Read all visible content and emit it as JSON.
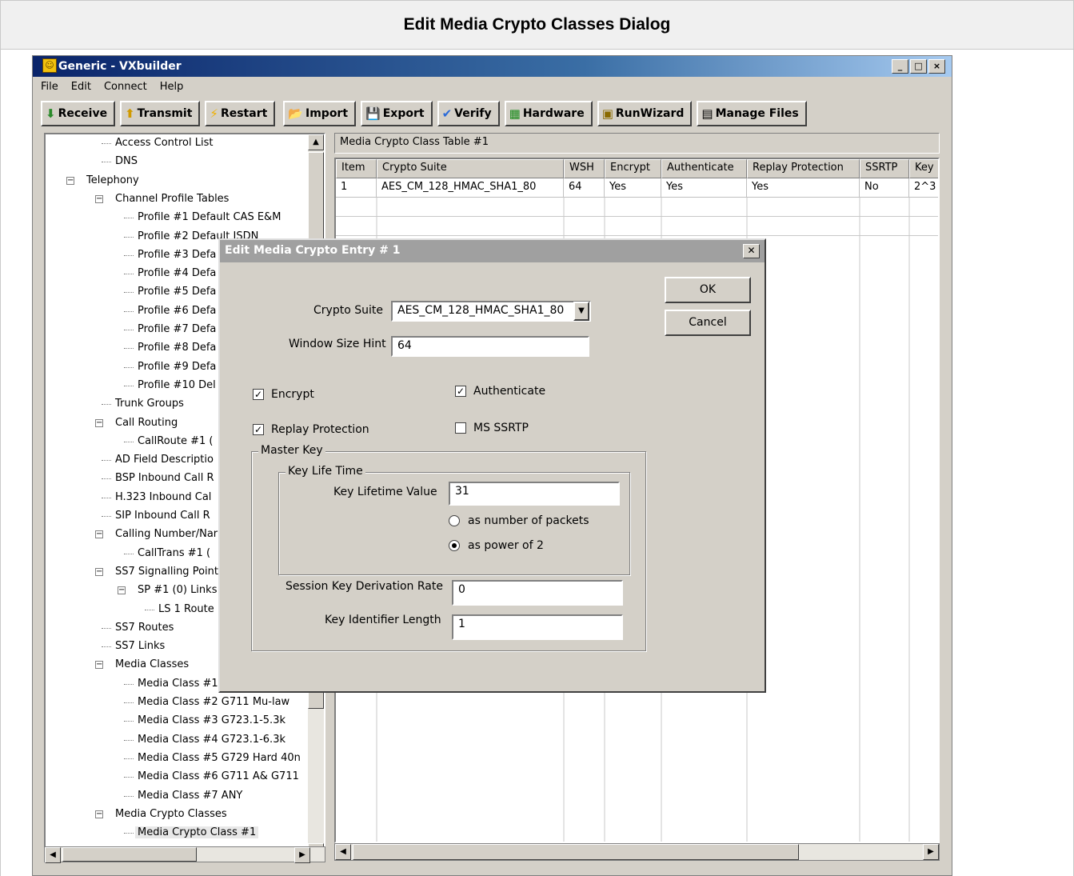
{
  "caption": "Edit Media Crypto Classes Dialog",
  "window": {
    "title": "Generic - VXbuilder",
    "controls": [
      "_",
      "□",
      "×"
    ]
  },
  "menu": [
    "File",
    "Edit",
    "Connect",
    "Help"
  ],
  "toolbar": [
    {
      "label": "Receive",
      "icon": "receive-icon"
    },
    {
      "label": "Transmit",
      "icon": "transmit-icon"
    },
    {
      "label": "Restart",
      "icon": "restart-icon"
    },
    {
      "label": "Import",
      "icon": "import-icon"
    },
    {
      "label": "Export",
      "icon": "export-icon"
    },
    {
      "label": "Verify",
      "icon": "verify-icon"
    },
    {
      "label": "Hardware",
      "icon": "hardware-icon"
    },
    {
      "label": "RunWizard",
      "icon": "runwizard-icon"
    },
    {
      "label": "Manage Files",
      "icon": "manage-files-icon"
    }
  ],
  "tree": [
    "Access Control List",
    "DNS",
    "Telephony",
    "Channel Profile Tables",
    "Profile #1 Default CAS E&M",
    "Profile #2 Default ISDN",
    "Profile #3 Defa",
    "Profile #4 Defa",
    "Profile #5 Defa",
    "Profile #6 Defa",
    "Profile #7 Defa",
    "Profile #8 Defa",
    "Profile #9 Defa",
    "Profile #10 Del",
    "Trunk Groups",
    "Call Routing",
    "CallRoute #1 (",
    "AD Field Descriptio",
    "BSP Inbound Call R",
    "H.323 Inbound Cal",
    "SIP Inbound Call R",
    "Calling Number/Nar",
    "CallTrans #1 (",
    "SS7 Signalling Point",
    "SP #1 (0) Links",
    "LS 1 Route",
    "SS7 Routes",
    "SS7 Links",
    "Media Classes",
    "Media Class #1",
    "Media Class #2 G711 Mu-law",
    "Media Class #3 G723.1-5.3k",
    "Media Class #4 G723.1-6.3k",
    "Media Class #5 G729 Hard 40n",
    "Media Class #6 G711 A& G711",
    "Media Class #7 ANY",
    "Media Crypto Classes",
    "Media Crypto Class #1"
  ],
  "table": {
    "title": "Media Crypto Class Table #1",
    "headers": [
      "Item",
      "Crypto Suite",
      "WSH",
      "Encrypt",
      "Authenticate",
      "Replay Protection",
      "SSRTP",
      "Key"
    ],
    "rows": [
      [
        "1",
        "AES_CM_128_HMAC_SHA1_80",
        "64",
        "Yes",
        "Yes",
        "Yes",
        "No",
        "2^3"
      ]
    ]
  },
  "dialog": {
    "title": "Edit Media Crypto Entry # 1",
    "ok": "OK",
    "cancel": "Cancel",
    "crypto_suite_label": "Crypto Suite",
    "crypto_suite_value": "AES_CM_128_HMAC_SHA1_80",
    "window_size_label": "Window Size Hint",
    "window_size_value": "64",
    "encrypt_label": "Encrypt",
    "encrypt_checked": true,
    "authenticate_label": "Authenticate",
    "authenticate_checked": true,
    "replay_label": "Replay Protection",
    "replay_checked": true,
    "ms_ssrtp_label": "MS SSRTP",
    "ms_ssrtp_checked": false,
    "master_key_label": "Master Key",
    "key_life_time_label": "Key Life Time",
    "key_lifetime_value_label": "Key Lifetime Value",
    "key_lifetime_value": "31",
    "radio_packets_label": "as number of packets",
    "radio_power_label": "as power of 2",
    "radio_selected": "power",
    "session_rate_label": "Session Key Derivation Rate",
    "session_rate_value": "0",
    "key_id_length_label": "Key Identifier Length",
    "key_id_length_value": "1"
  }
}
